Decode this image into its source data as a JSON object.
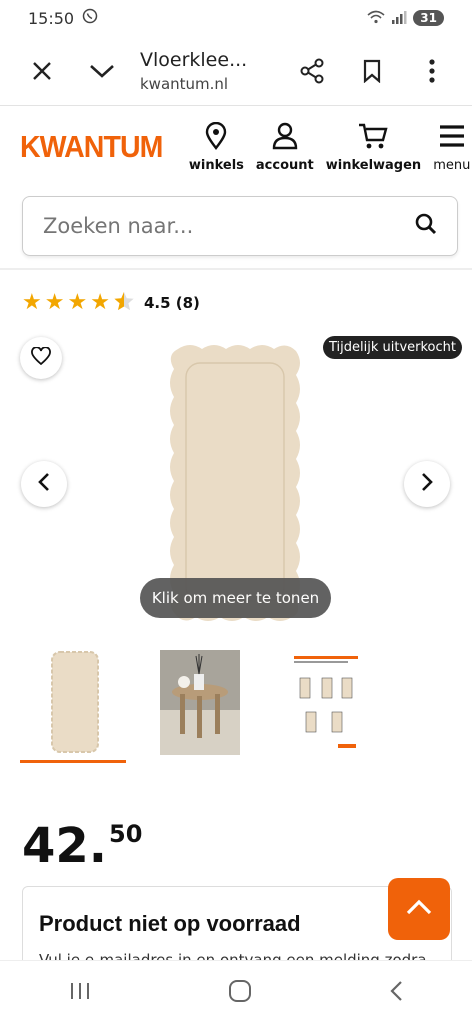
{
  "statusbar": {
    "time": "15:50",
    "battery": "31"
  },
  "browser": {
    "title": "Vloerklee...",
    "domain": "kwantum.nl"
  },
  "site": {
    "logo": "KWANTUM",
    "nav": [
      {
        "label": "winkels",
        "icon": "location-pin-icon"
      },
      {
        "label": "account",
        "icon": "user-icon"
      },
      {
        "label": "winkelwagen",
        "icon": "cart-icon"
      },
      {
        "label": "menu",
        "icon": "hamburger-icon"
      }
    ],
    "search_placeholder": "Zoeken naar..."
  },
  "product": {
    "rating_text": "4.5 (8)",
    "rating_value": 4.5,
    "badge": "Tijdelijk uitverkocht",
    "toast": "Klik om meer te tonen",
    "price_int": "42.",
    "price_dec": "50",
    "stock_title": "Product niet op voorraad",
    "stock_text": "Vul je e-mailadres in en ontvang een melding zodra"
  },
  "colors": {
    "accent": "#f0620a",
    "star": "#f2a600"
  }
}
